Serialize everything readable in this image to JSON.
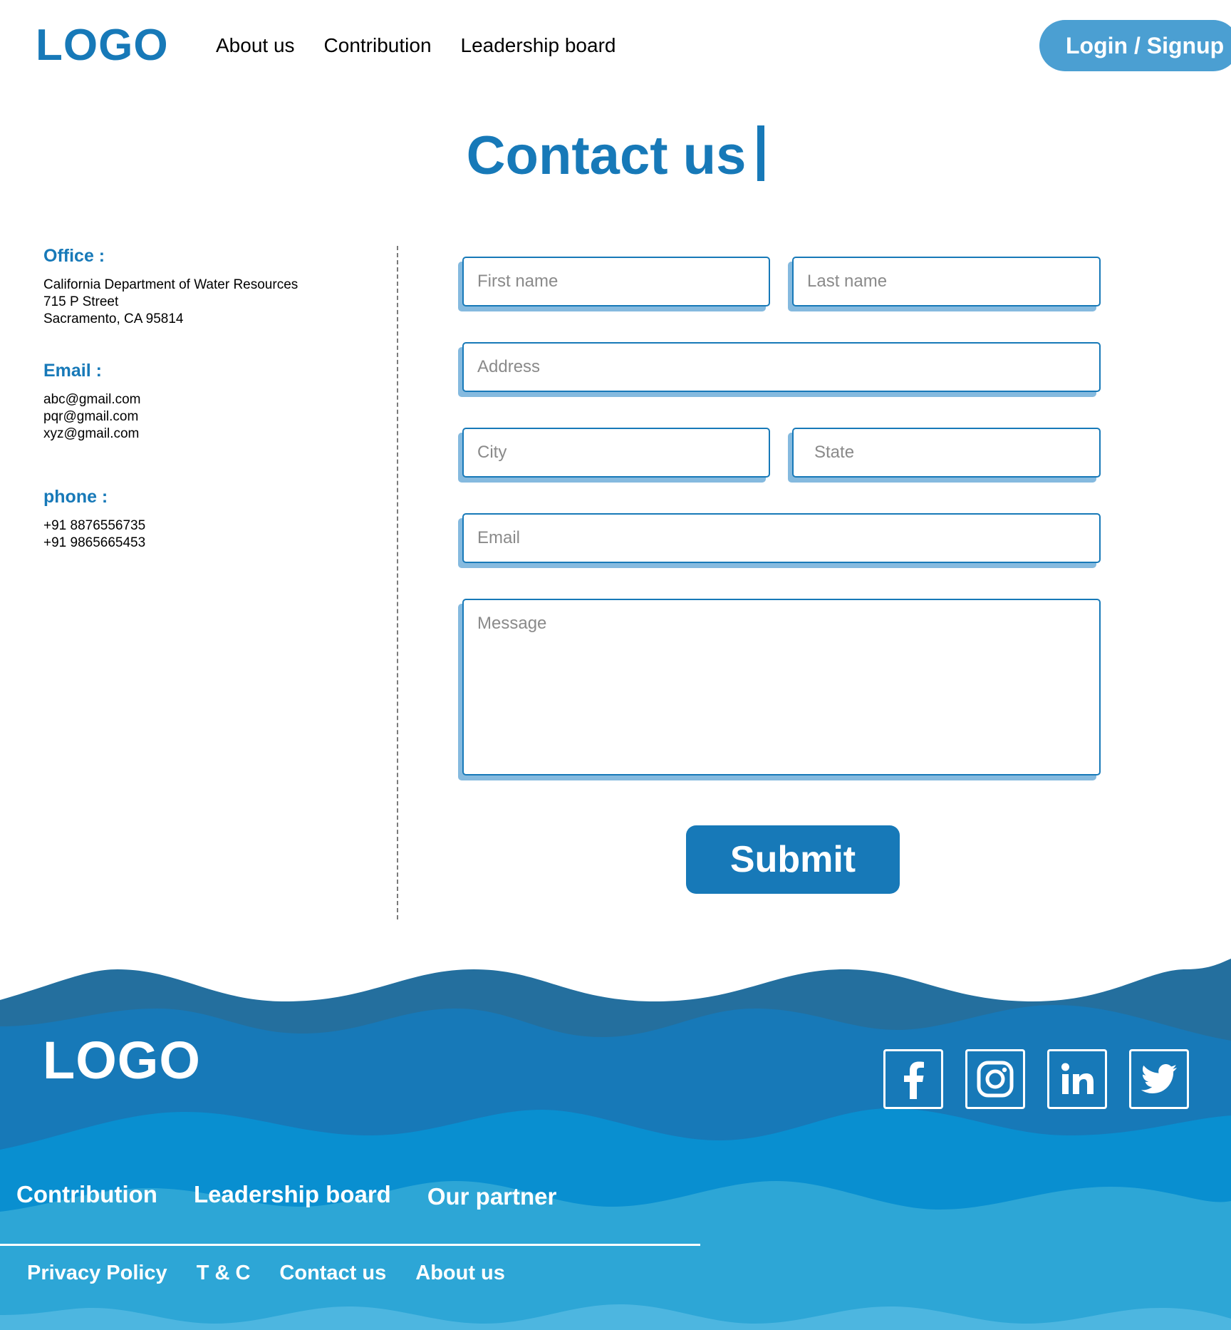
{
  "header": {
    "logo": "LOGO",
    "nav": [
      "About us",
      "Contribution",
      "Leadership board"
    ],
    "login_label": "Login / Signup"
  },
  "title": "Contact us",
  "contact": {
    "office_heading": "Office :",
    "office_lines": [
      "California Department of Water Resources",
      "715 P Street",
      "Sacramento, CA 95814"
    ],
    "email_heading": "Email :",
    "emails": [
      "abc@gmail.com",
      "pqr@gmail.com",
      "xyz@gmail.com"
    ],
    "phone_heading": "phone :",
    "phones": [
      "+91 8876556735",
      "+91 9865665453"
    ]
  },
  "form": {
    "first_name": "First name",
    "last_name": "Last name",
    "address": "Address",
    "city": "City",
    "state": "State",
    "email": "Email",
    "message": "Message",
    "submit": "Submit"
  },
  "footer": {
    "logo": "LOGO",
    "socials": [
      "facebook-icon",
      "instagram-icon",
      "linkedin-icon",
      "twitter-icon"
    ],
    "nav_primary": [
      "Contribution",
      "Leadership board",
      "Our partner"
    ],
    "nav_secondary": [
      "Privacy Policy",
      "T & C",
      "Contact us",
      "About us"
    ]
  },
  "colors": {
    "brand": "#1779b8",
    "login_button": "#4b9fd2",
    "wave_dark": "#246f9e",
    "wave_mid": "#1779b8",
    "wave_bright": "#098fd0",
    "wave_light": "#2da6d6",
    "wave_lightest": "#4db6e0"
  }
}
